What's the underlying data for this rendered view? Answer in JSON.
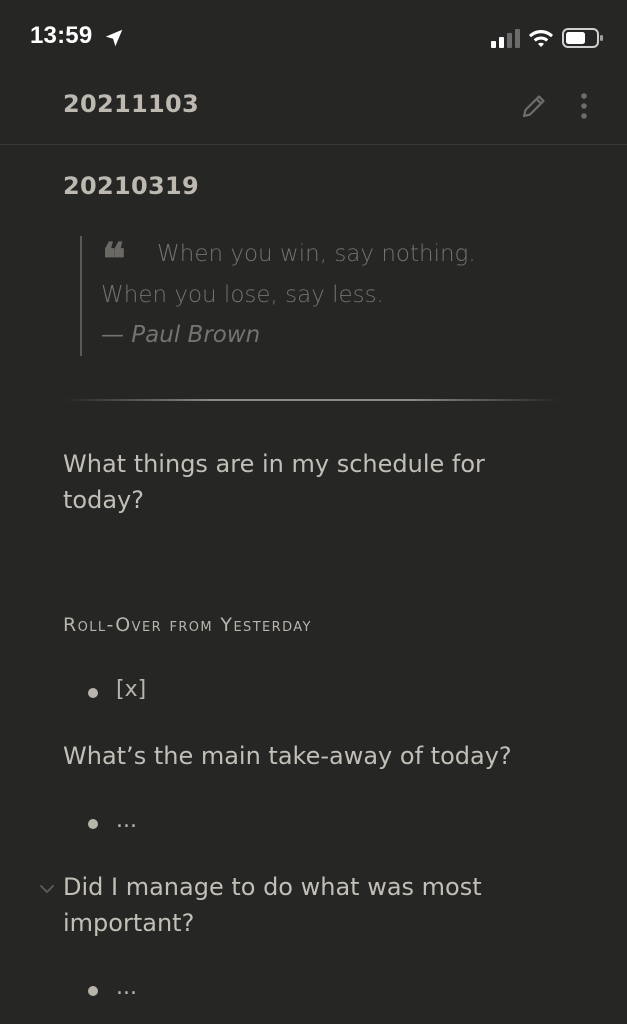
{
  "status_bar": {
    "time": "13:59",
    "icons": [
      "location-arrow-icon",
      "cellular-signal-icon",
      "wifi-icon",
      "battery-icon"
    ]
  },
  "header": {
    "title": "20211103",
    "actions": [
      "pencil-icon",
      "more-vertical-icon"
    ]
  },
  "note": {
    "heading": "20210319",
    "quote": {
      "mark": "❝",
      "line1": "When you win, say nothing.",
      "line2": "When you lose, say less.",
      "author": "— Paul Brown"
    },
    "question1": "What things are in my schedule for today?",
    "section_label": "Roll-Over from Yesterday",
    "bullet1": "[x]",
    "question2": "What’s the main take-away of today?",
    "bullet2": "...",
    "question3": "Did I manage to do what was most important?",
    "bullet3": "..."
  },
  "colors": {
    "background": "#262625",
    "text": "#c2bfb7",
    "muted_text": "#75736d",
    "status_text": "#ffffff"
  }
}
